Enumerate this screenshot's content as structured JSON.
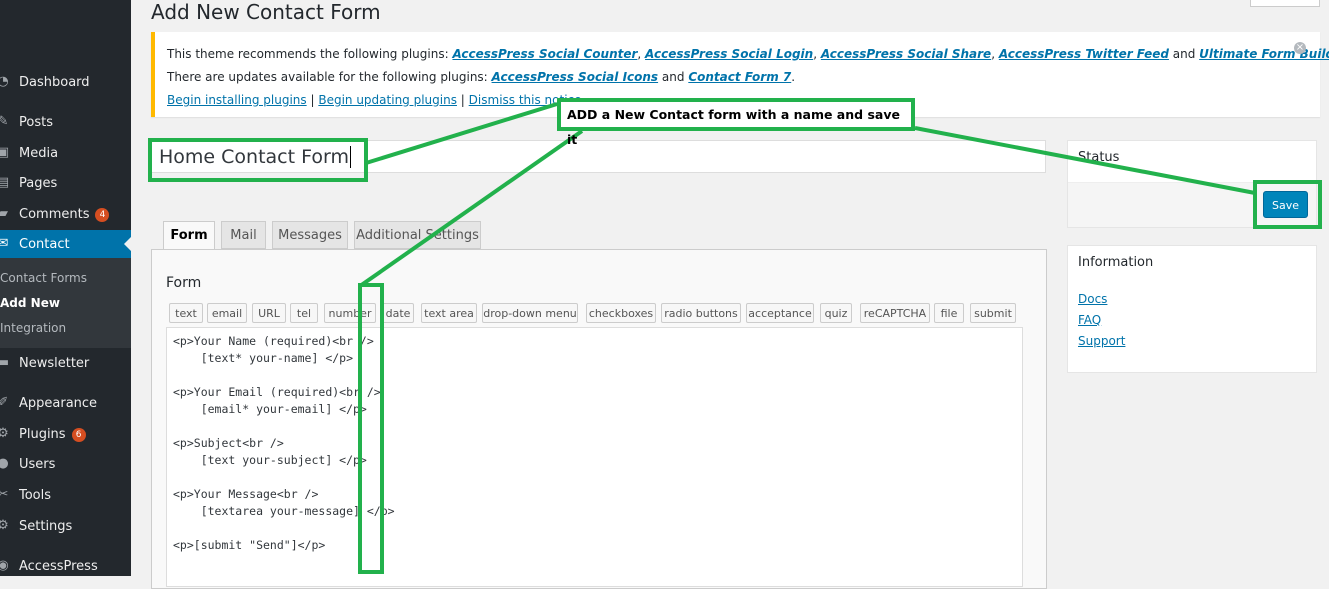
{
  "sidebar": {
    "items": [
      {
        "label": "Dashboard",
        "icon": "dashboard-icon",
        "glyph": "◔"
      },
      {
        "label": "Posts",
        "icon": "pin-icon",
        "glyph": "✎"
      },
      {
        "label": "Media",
        "icon": "media-icon",
        "glyph": "▣"
      },
      {
        "label": "Pages",
        "icon": "pages-icon",
        "glyph": "▤"
      },
      {
        "label": "Comments",
        "icon": "comments-icon",
        "glyph": "▰",
        "badge": "4"
      },
      {
        "label": "Contact",
        "icon": "mail-icon",
        "glyph": "✉"
      },
      {
        "label": "Newsletter",
        "icon": "newsletter-icon",
        "glyph": "▬"
      },
      {
        "label": "Appearance",
        "icon": "paintbrush-icon",
        "glyph": "✐"
      },
      {
        "label": "Plugins",
        "icon": "plugins-icon",
        "glyph": "⚙",
        "badge": "6"
      },
      {
        "label": "Users",
        "icon": "users-icon",
        "glyph": "●"
      },
      {
        "label": "Tools",
        "icon": "tools-icon",
        "glyph": "✂"
      },
      {
        "label": "Settings",
        "icon": "settings-icon",
        "glyph": "⚙"
      },
      {
        "label": "AccessPress",
        "icon": "accesspress-icon",
        "glyph": "◉"
      }
    ],
    "submenu": [
      "Contact Forms",
      "Add New",
      "Integration"
    ]
  },
  "page_title": "Add New Contact Form",
  "notice": {
    "line1_prefix": "This theme recommends the following plugins: ",
    "recommended": [
      "AccessPress Social Counter",
      "AccessPress Social Login",
      "AccessPress Social Share",
      "AccessPress Twitter Feed",
      "Ultimate Form Builder Lite"
    ],
    "line2_prefix": "There are updates available for the following plugins: ",
    "updates": [
      "AccessPress Social Icons",
      "Contact Form 7"
    ],
    "and": "and",
    "sep": ", ",
    "end": ".",
    "actions": [
      "Begin installing plugins",
      "Begin updating plugins",
      "Dismiss this notice"
    ],
    "pipe": "|"
  },
  "title_input": {
    "value": "Home Contact Form"
  },
  "tabs": [
    "Form",
    "Mail",
    "Messages",
    "Additional Settings"
  ],
  "form": {
    "heading": "Form",
    "tag_buttons": [
      "text",
      "email",
      "URL",
      "tel",
      "number",
      "date",
      "text area",
      "drop-down menu",
      "checkboxes",
      "radio buttons",
      "acceptance",
      "quiz",
      "reCAPTCHA",
      "file",
      "submit"
    ],
    "code_lines": [
      "<p>Your Name (required)<br />",
      "    [text* your-name] </p>",
      "",
      "<p>Your Email (required)<br />",
      "    [email* your-email] </p>",
      "",
      "<p>Subject<br />",
      "    [text your-subject] </p>",
      "",
      "<p>Your Message<br />",
      "    [textarea your-message] </p>",
      "",
      "<p>[submit \"Send\"]</p>"
    ]
  },
  "status_box": {
    "title": "Status",
    "save_label": "Save"
  },
  "info_box": {
    "title": "Information",
    "links": [
      "Docs",
      "FAQ",
      "Support"
    ]
  },
  "annotation": {
    "text": "ADD a New Contact form with a name and save it",
    "color": "#22b14c"
  }
}
